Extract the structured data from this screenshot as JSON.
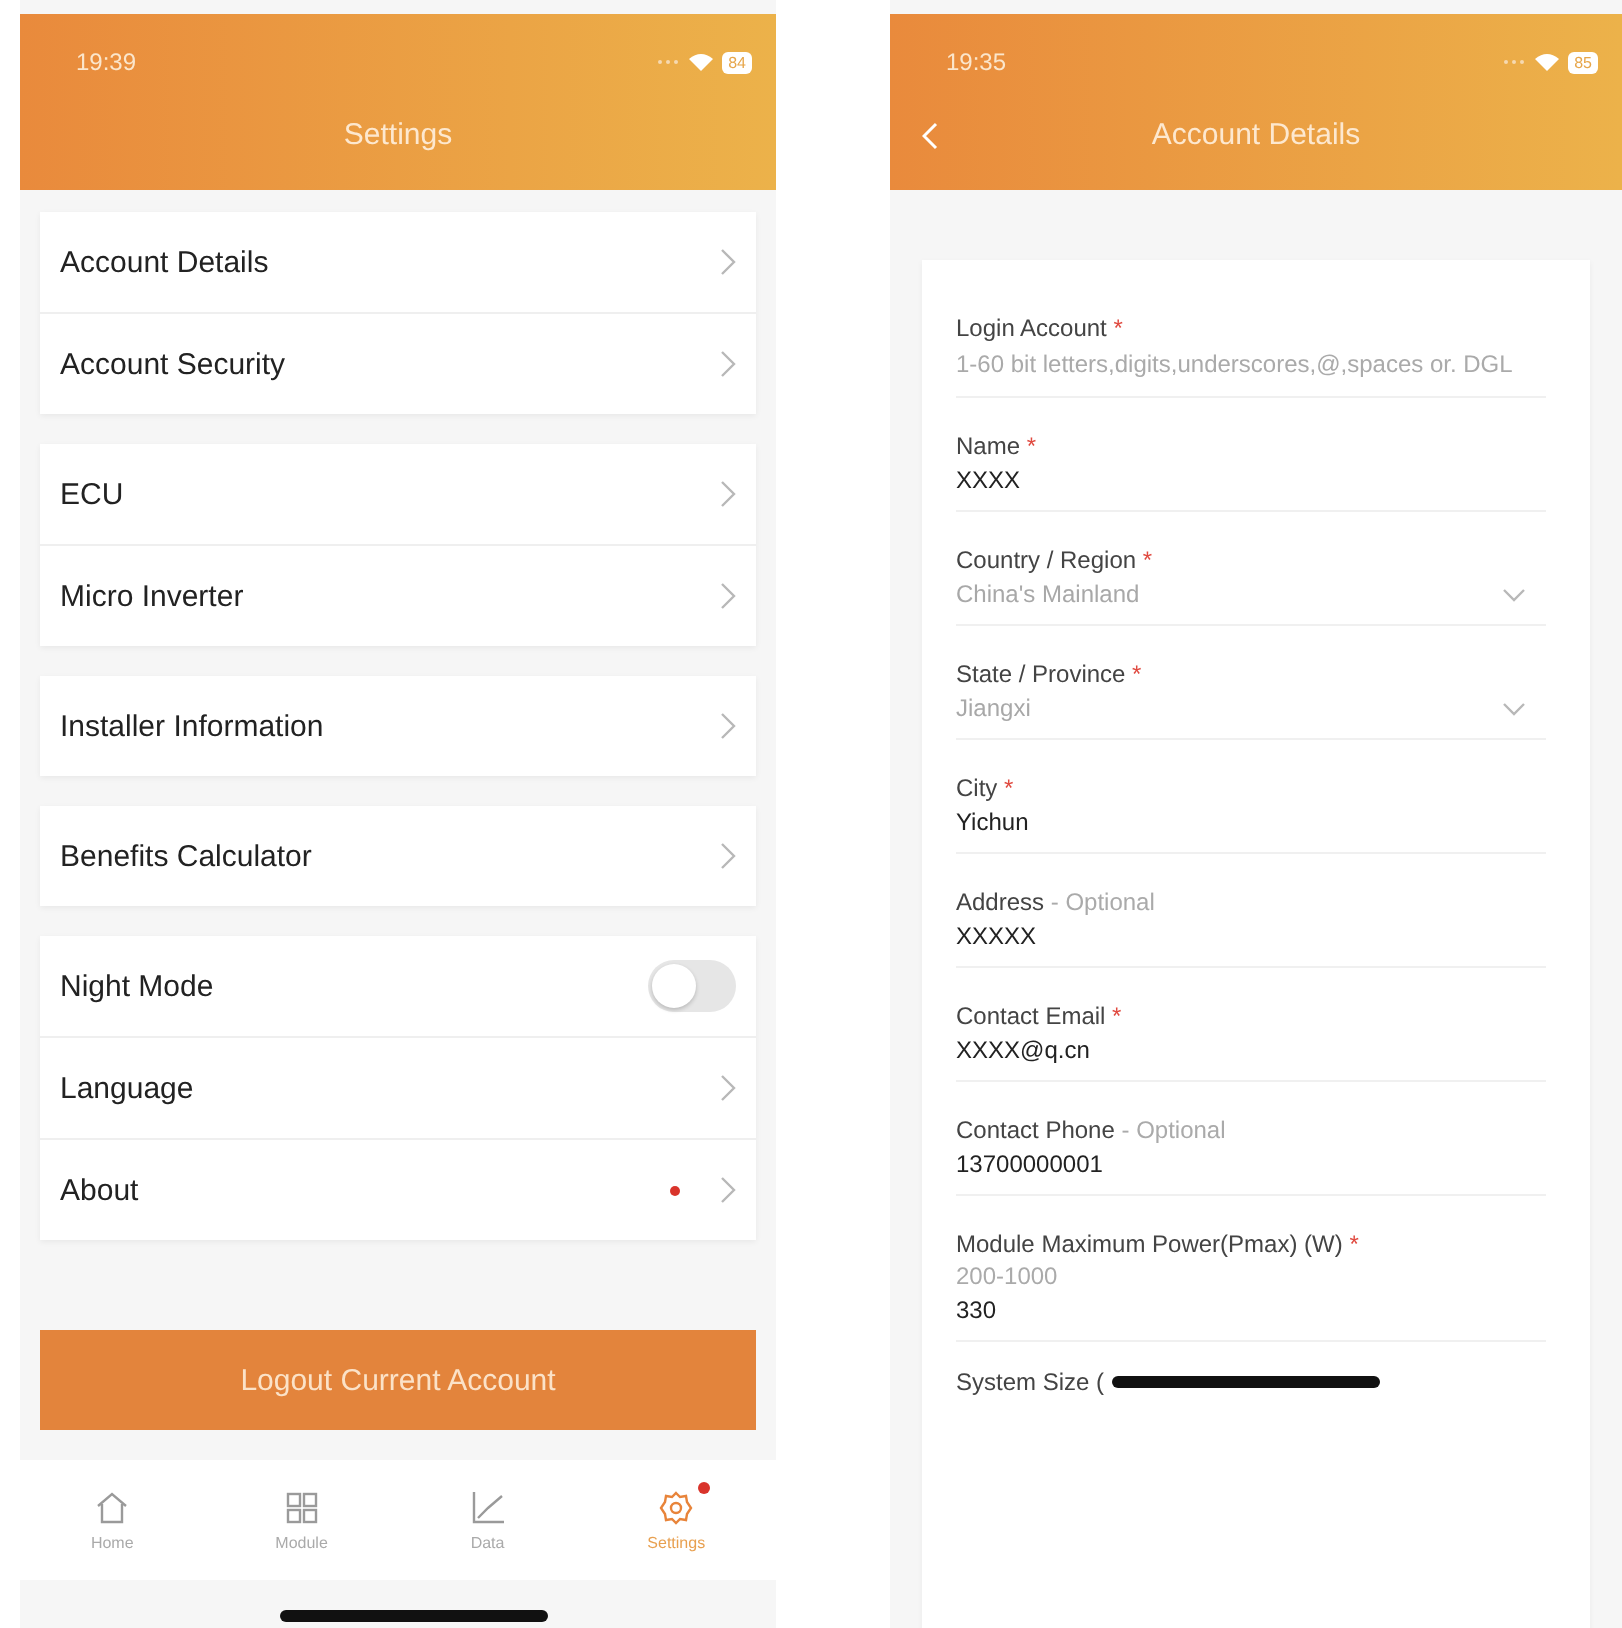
{
  "settings_screen": {
    "status_bar": {
      "time": "19:39",
      "battery": "84"
    },
    "title": "Settings",
    "groups": [
      [
        {
          "label": "Account Details",
          "kind": "link",
          "badge": false
        },
        {
          "label": "Account Security",
          "kind": "link",
          "badge": false
        }
      ],
      [
        {
          "label": "ECU",
          "kind": "link",
          "badge": false
        },
        {
          "label": "Micro Inverter",
          "kind": "link",
          "badge": false
        }
      ],
      [
        {
          "label": "Installer Information",
          "kind": "link",
          "badge": false
        }
      ],
      [
        {
          "label": "Benefits Calculator",
          "kind": "link",
          "badge": false
        }
      ],
      [
        {
          "label": "Night Mode",
          "kind": "toggle",
          "on": false
        },
        {
          "label": "Language",
          "kind": "link",
          "badge": false
        },
        {
          "label": "About",
          "kind": "link",
          "badge": true
        }
      ]
    ],
    "logout_button": "Logout Current Account",
    "tab_bar": [
      {
        "label": "Home",
        "selected": false,
        "badge": false
      },
      {
        "label": "Module",
        "selected": false,
        "badge": false
      },
      {
        "label": "Data",
        "selected": false,
        "badge": false
      },
      {
        "label": "Settings",
        "selected": true,
        "badge": true
      }
    ]
  },
  "account_screen": {
    "status_bar": {
      "time": "19:35",
      "battery": "85"
    },
    "title": "Account Details",
    "fields": [
      {
        "label": "Login Account",
        "note": {
          "text": "*",
          "kind": "required"
        },
        "placeholder": "1-60 bit letters,digits,underscores,@,spaces or. DGL",
        "kind": "text"
      },
      {
        "label": "Name",
        "note": {
          "text": "*",
          "kind": "required"
        },
        "value": "XXXX",
        "kind": "text"
      },
      {
        "label": "Country / Region",
        "note": {
          "text": "*",
          "kind": "required"
        },
        "value": "China's Mainland",
        "kind": "select",
        "disabled": true
      },
      {
        "label": "State / Province",
        "note": {
          "text": "*",
          "kind": "required"
        },
        "value": "Jiangxi",
        "kind": "select",
        "disabled": true
      },
      {
        "label": "City",
        "note": {
          "text": "*",
          "kind": "required"
        },
        "value": "Yichun",
        "kind": "text"
      },
      {
        "label": "Address",
        "note": {
          "text": "- Optional",
          "kind": "optional"
        },
        "value": "XXXXX",
        "kind": "text"
      },
      {
        "label": "Contact Email",
        "note": {
          "text": "*",
          "kind": "required"
        },
        "value": "XXXX@q.cn",
        "kind": "text"
      },
      {
        "label": "Contact Phone",
        "note": {
          "text": "- Optional",
          "kind": "optional"
        },
        "value": "13700000001",
        "kind": "text"
      },
      {
        "label": "Module Maximum Power(Pmax) (W)",
        "note": {
          "text": "*",
          "kind": "required"
        },
        "hint": "200-1000",
        "value": "330",
        "kind": "text"
      },
      {
        "label": "System Size (",
        "kind": "cut"
      }
    ]
  }
}
